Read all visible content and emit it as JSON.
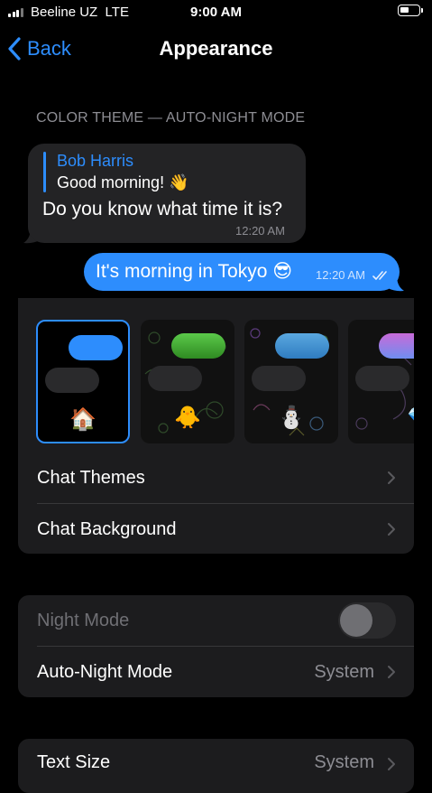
{
  "status_bar": {
    "carrier": "Beeline UZ",
    "network": "LTE",
    "time": "9:00 AM"
  },
  "nav": {
    "back_label": "Back",
    "title": "Appearance"
  },
  "preview": {
    "section_header": "COLOR THEME — AUTO-NIGHT MODE",
    "incoming": {
      "reply_name": "Bob Harris",
      "reply_text": "Good morning! 👋",
      "text": "Do you know what time it is?",
      "time": "12:20 AM"
    },
    "outgoing": {
      "text": "It's morning in Tokyo 😎",
      "time": "12:20 AM"
    }
  },
  "themes": [
    {
      "emoji": "🏠",
      "selected": true,
      "bubble_color": "#2d8dfd"
    },
    {
      "emoji": "🐥",
      "selected": false,
      "bubble_color": "#3f9e2c"
    },
    {
      "emoji": "⛄",
      "selected": false,
      "bubble_color": "#3a8fd0"
    },
    {
      "emoji": "💎",
      "selected": false,
      "bubble_color": "#9a7ee8"
    }
  ],
  "theme_rows": {
    "chat_themes": "Chat Themes",
    "chat_background": "Chat Background"
  },
  "night_group": {
    "night_mode_label": "Night Mode",
    "night_mode_on": false,
    "auto_night_label": "Auto-Night Mode",
    "auto_night_value": "System"
  },
  "text_group": {
    "text_size_label": "Text Size",
    "text_size_value": "System"
  },
  "colors": {
    "accent": "#2d8dfd",
    "background": "#000000",
    "card": "#1c1c1e",
    "secondary_text": "#8d8d93"
  }
}
